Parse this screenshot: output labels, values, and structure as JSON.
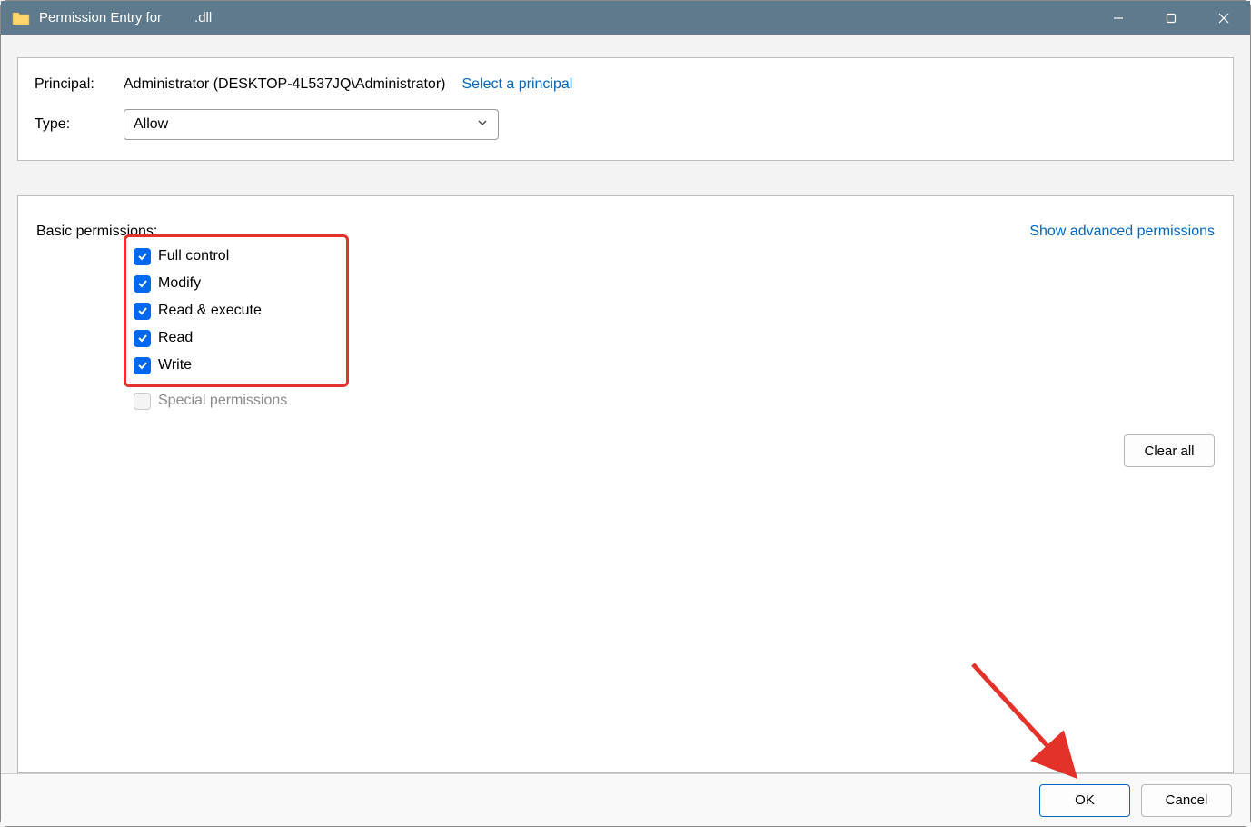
{
  "window": {
    "title_prefix": "Permission Entry for",
    "title_filename": ".dll"
  },
  "principal": {
    "label": "Principal:",
    "value": "Administrator (DESKTOP-4L537JQ\\Administrator)",
    "select_link": "Select a principal"
  },
  "type": {
    "label": "Type:",
    "value": "Allow"
  },
  "permissions": {
    "section_label": "Basic permissions:",
    "advanced_link": "Show advanced permissions",
    "items": [
      {
        "label": "Full control",
        "checked": true,
        "disabled": false
      },
      {
        "label": "Modify",
        "checked": true,
        "disabled": false
      },
      {
        "label": "Read & execute",
        "checked": true,
        "disabled": false
      },
      {
        "label": "Read",
        "checked": true,
        "disabled": false
      },
      {
        "label": "Write",
        "checked": true,
        "disabled": false
      },
      {
        "label": "Special permissions",
        "checked": false,
        "disabled": true
      }
    ],
    "clear_all": "Clear all"
  },
  "footer": {
    "ok": "OK",
    "cancel": "Cancel"
  }
}
